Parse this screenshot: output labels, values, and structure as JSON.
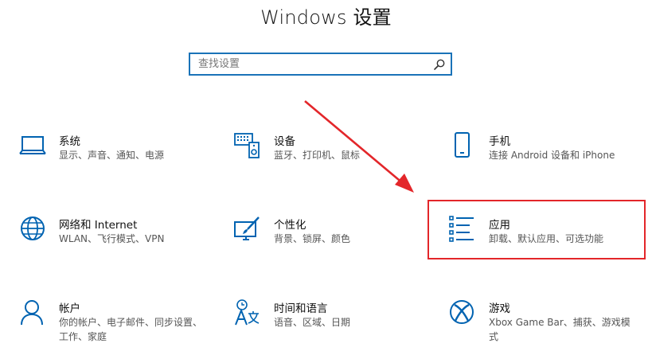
{
  "window": {
    "title": "Windows 设置"
  },
  "search": {
    "placeholder": "查找设置"
  },
  "tiles": [
    {
      "name": "系统",
      "desc": "显示、声音、通知、电源",
      "icon": "laptop-icon"
    },
    {
      "name": "设备",
      "desc": "蓝牙、打印机、鼠标",
      "icon": "devices-icon"
    },
    {
      "name": "手机",
      "desc": "连接 Android 设备和 iPhone",
      "icon": "phone-icon"
    },
    {
      "name": "网络和 Internet",
      "desc": "WLAN、飞行模式、VPN",
      "icon": "globe-icon"
    },
    {
      "name": "个性化",
      "desc": "背景、锁屏、颜色",
      "icon": "paintbrush-icon"
    },
    {
      "name": "应用",
      "desc": "卸载、默认应用、可选功能",
      "icon": "apps-list-icon"
    },
    {
      "name": "帐户",
      "desc": "你的帐户、电子邮件、同步设置、工作、家庭",
      "icon": "person-icon"
    },
    {
      "name": "时间和语言",
      "desc": "语音、区域、日期",
      "icon": "time-language-icon"
    },
    {
      "name": "游戏",
      "desc": "Xbox Game Bar、捕获、游戏模式",
      "icon": "xbox-icon"
    }
  ],
  "colors": {
    "accent": "#0063b1",
    "highlight": "#e3262a",
    "search_border": "#1a73b8"
  }
}
